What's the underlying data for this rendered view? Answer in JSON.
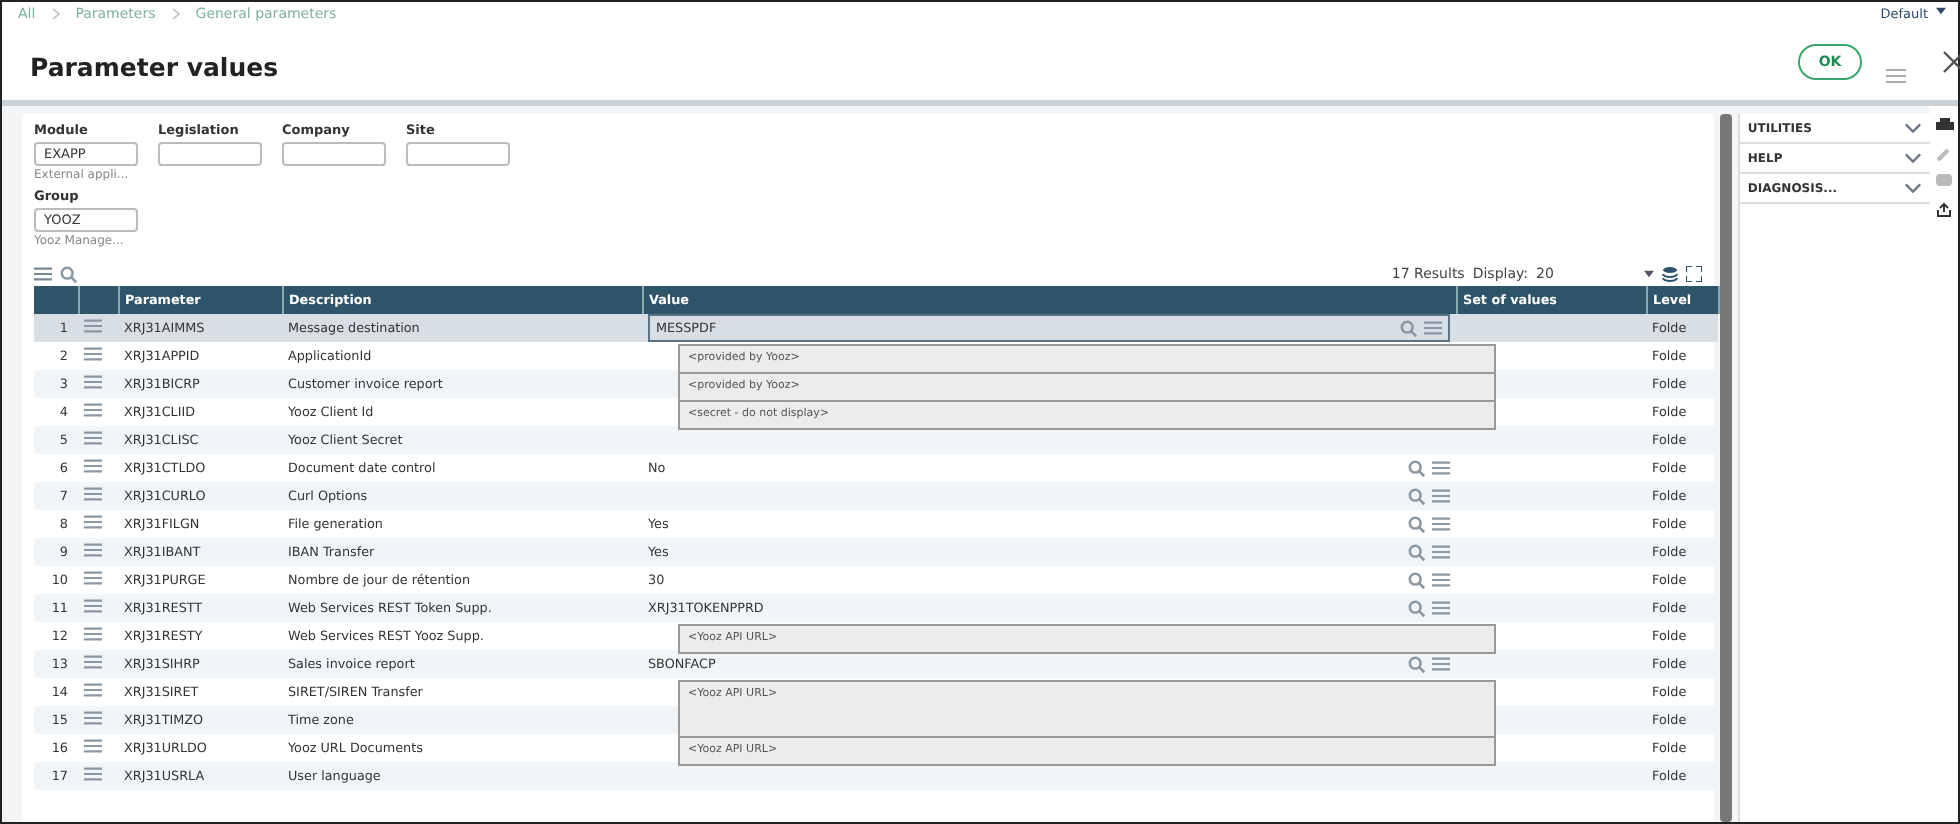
{
  "breadcrumb": [
    "All",
    "Parameters",
    "General parameters"
  ],
  "user_menu": {
    "label": "Default"
  },
  "title": "Parameter values",
  "ok_button": "OK",
  "criteria": [
    {
      "label": "Module",
      "value": "EXAPP",
      "hint": "External appli..."
    },
    {
      "label": "Legislation"
    },
    {
      "label": "Company"
    },
    {
      "label": "Site"
    }
  ],
  "group": {
    "label": "Group",
    "value": "YOOZ",
    "hint": "Yooz Manage..."
  },
  "grid": {
    "results": "17 Results",
    "display_label": "Display:",
    "display_value": "20",
    "columns": [
      "Parameter",
      "Description",
      "Value",
      "Set of values",
      "Level"
    ],
    "rows": [
      {
        "num": "1",
        "parameter": "XRJ31AIMMS",
        "description": "Message destination",
        "value": "MESSPDF",
        "level": "Folde",
        "selected": true,
        "lookup": true
      },
      {
        "num": "2",
        "parameter": "XRJ31APPID",
        "description": "ApplicationId",
        "note": {
          "text": "<provided by Yooz>",
          "kind": "short"
        },
        "level": "Folde",
        "selected": false,
        "lookup": false
      },
      {
        "num": "3",
        "parameter": "XRJ31BICRP",
        "description": "Customer invoice report",
        "note": {
          "text": "<provided by Yooz>",
          "kind": "short"
        },
        "level": "Folde",
        "selected": false,
        "lookup": false
      },
      {
        "num": "4",
        "parameter": "XRJ31CLIID",
        "description": "Yooz Client Id",
        "note": {
          "text": "<secret - do not display>",
          "kind": "short"
        },
        "level": "Folde",
        "selected": false,
        "lookup": false
      },
      {
        "num": "5",
        "parameter": "XRJ31CLISC",
        "description": "Yooz Client Secret",
        "level": "Folde",
        "selected": false,
        "lookup": false
      },
      {
        "num": "6",
        "parameter": "XRJ31CTLDO",
        "description": "Document date control",
        "value": "No",
        "level": "Folde",
        "selected": false,
        "lookup": true
      },
      {
        "num": "7",
        "parameter": "XRJ31CURLO",
        "description": "Curl Options",
        "level": "Folde",
        "selected": false,
        "lookup": true
      },
      {
        "num": "8",
        "parameter": "XRJ31FILGN",
        "description": "File generation",
        "value": "Yes",
        "level": "Folde",
        "selected": false,
        "lookup": true
      },
      {
        "num": "9",
        "parameter": "XRJ31IBANT",
        "description": "IBAN Transfer",
        "value": "Yes",
        "level": "Folde",
        "selected": false,
        "lookup": true
      },
      {
        "num": "10",
        "parameter": "XRJ31PURGE",
        "description": "Nombre de jour de rétention",
        "value": "30",
        "level": "Folde",
        "selected": false,
        "lookup": true
      },
      {
        "num": "11",
        "parameter": "XRJ31RESTT",
        "description": "Web Services REST Token Supp.",
        "value": "XRJ31TOKENPPRD",
        "level": "Folde",
        "selected": false,
        "lookup": true
      },
      {
        "num": "12",
        "parameter": "XRJ31RESTY",
        "description": "Web Services REST Yooz Supp.",
        "note": {
          "text": "<Yooz API URL>",
          "kind": "short"
        },
        "level": "Folde",
        "selected": false,
        "lookup": false
      },
      {
        "num": "13",
        "parameter": "XRJ31SIHRP",
        "description": "Sales invoice report",
        "value": "SBONFACP",
        "level": "Folde",
        "selected": false,
        "lookup": true
      },
      {
        "num": "14",
        "parameter": "XRJ31SIRET",
        "description": "SIRET/SIREN Transfer",
        "note": {
          "text": "<Yooz API URL>",
          "kind": "tall"
        },
        "level": "Folde",
        "selected": false,
        "lookup": false
      },
      {
        "num": "15",
        "parameter": "XRJ31TIMZO",
        "description": "Time zone",
        "level": "Folde",
        "selected": false,
        "lookup": false
      },
      {
        "num": "16",
        "parameter": "XRJ31URLDO",
        "description": "Yooz URL Documents",
        "note": {
          "text": "<Yooz API URL>",
          "kind": "short"
        },
        "level": "Folde",
        "selected": false,
        "lookup": false
      },
      {
        "num": "17",
        "parameter": "XRJ31USRLA",
        "description": "User language",
        "level": "Folde",
        "selected": false,
        "lookup": false
      }
    ]
  },
  "side_panel": [
    {
      "label": "UTILITIES",
      "expanded": false
    },
    {
      "label": "HELP",
      "expanded": false
    },
    {
      "label": "DIAGNOSIS...",
      "expanded": false
    }
  ]
}
